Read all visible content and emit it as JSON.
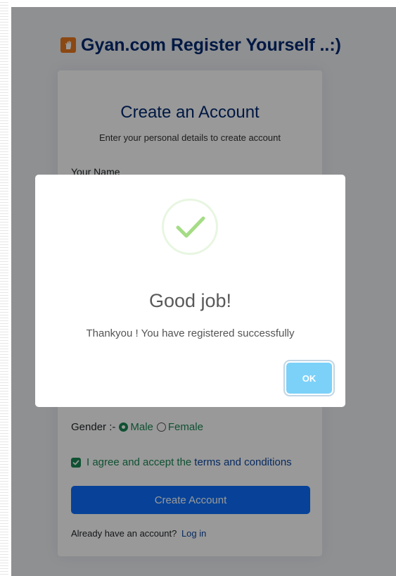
{
  "brand": {
    "title": "Gyan.com Register Yourself ..:)",
    "logo_icon": "hand-logo-icon",
    "logo_color": "#e8781e"
  },
  "card": {
    "title": "Create an Account",
    "subtitle": "Enter your personal details to create account",
    "name_label": "Your Name",
    "gender_label": "Gender :-",
    "gender_options": [
      "Male",
      "Female"
    ],
    "gender_selected": "Male",
    "agree_text": "I agree and accept the",
    "terms_link": "terms and conditions",
    "agree_checked": true,
    "create_button": "Create Account",
    "login_prompt": "Already have an account?",
    "login_link": "Log in"
  },
  "modal": {
    "icon": "success-check-icon",
    "title": "Good job!",
    "text": "Thankyou ! You have registered successfully",
    "ok_button": "OK"
  },
  "colors": {
    "brand_navy": "#012970",
    "primary_blue": "#0d6efd",
    "success_green": "#198754",
    "ok_button_blue": "#7cd1f9",
    "check_green": "#a5dc86"
  }
}
